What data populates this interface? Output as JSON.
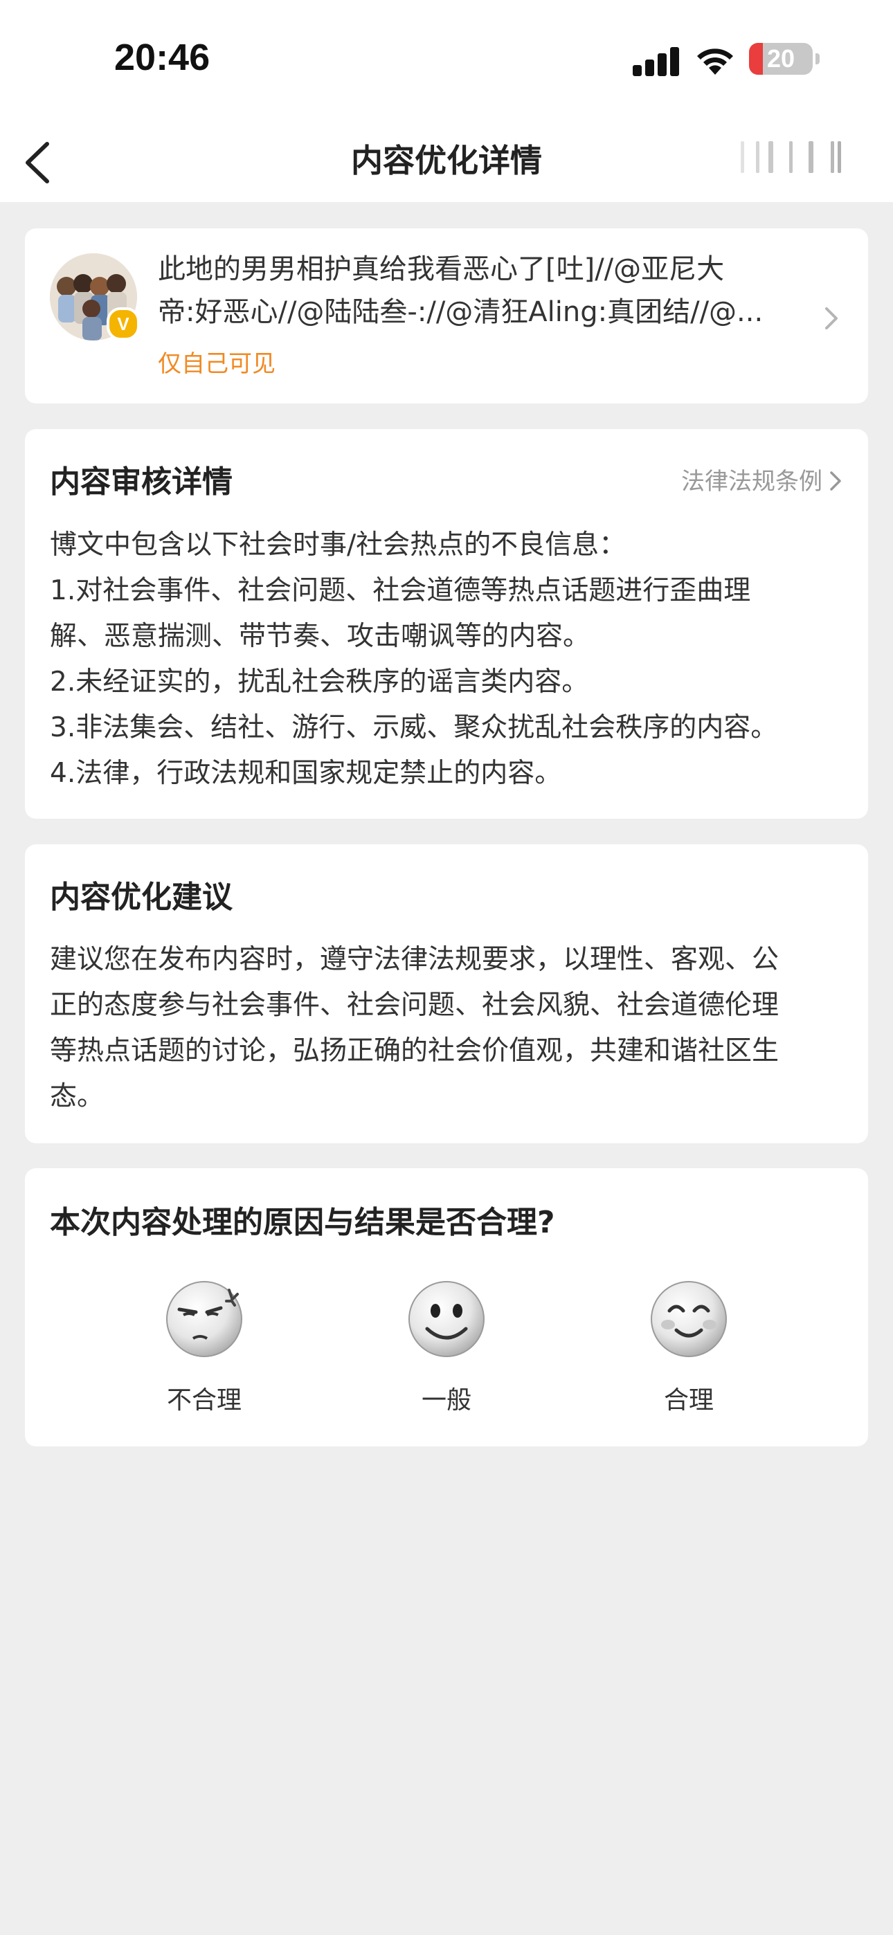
{
  "status_bar": {
    "time": "20:46",
    "battery": "20",
    "battery_color": "#ea3d3d"
  },
  "nav": {
    "title": "内容优化详情",
    "back_icon": "chevron-left-icon",
    "more_icon": "barcode-icon"
  },
  "post": {
    "text_line1": "此地的男男相护真给我看恶心了[吐]//@亚尼大",
    "text_line2": "帝:好恶心//@陆陆叁-://@清狂Aling:真团结//@...",
    "visibility": "仅自己可见",
    "badge": "V",
    "accent_color": "#f08a24"
  },
  "review": {
    "title": "内容审核详情",
    "law_link": "法律法规条例",
    "lines": [
      "博文中包含以下社会时事/社会热点的不良信息：",
      "1.对社会事件、社会问题、社会道德等热点话题进行歪曲理",
      "解、恶意揣测、带节奏、攻击嘲讽等的内容。",
      "2.未经证实的，扰乱社会秩序的谣言类内容。",
      "3.非法集会、结社、游行、示威、聚众扰乱社会秩序的内容。",
      "4.法律，行政法规和国家规定禁止的内容。"
    ]
  },
  "suggestion": {
    "title": "内容优化建议",
    "lines": [
      "建议您在发布内容时，遵守法律法规要求，以理性、客观、公",
      "正的态度参与社会事件、社会问题、社会风貌、社会道德伦理",
      "等热点话题的讨论，弘扬正确的社会价值观，共建和谐社区生",
      "态。"
    ]
  },
  "feedback": {
    "question": "本次内容处理的原因与结果是否合理?",
    "options": [
      {
        "label": "不合理",
        "icon": "angry-face-icon"
      },
      {
        "label": "一般",
        "icon": "neutral-smile-face-icon"
      },
      {
        "label": "合理",
        "icon": "happy-face-icon"
      }
    ]
  }
}
